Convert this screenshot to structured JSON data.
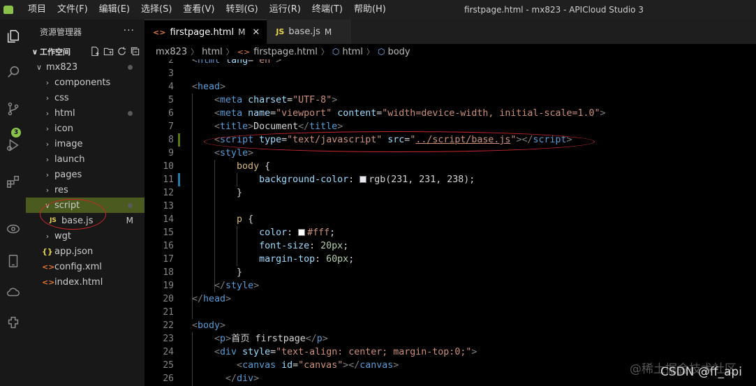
{
  "window": {
    "title": "firstpage.html - mx823 - APICloud Studio 3",
    "menu": [
      "项目",
      "文件(F)",
      "编辑(E)",
      "选择(S)",
      "查看(V)",
      "转到(G)",
      "运行(R)",
      "终端(T)",
      "帮助(H)"
    ]
  },
  "activity_bar": {
    "icons": [
      "explorer-icon",
      "search-icon",
      "source-control-icon",
      "run-debug-icon",
      "extensions-icon",
      "preview-icon",
      "device-icon",
      "cloud-icon",
      "plugin-icon"
    ],
    "scm_badge": "3"
  },
  "sidebar": {
    "title": "资源管理器",
    "more": "···",
    "workspace_label": "工作空间",
    "root": "mx823",
    "items": [
      {
        "label": "components",
        "kind": "folder",
        "expanded": false,
        "dot": false
      },
      {
        "label": "css",
        "kind": "folder",
        "expanded": false,
        "dot": false
      },
      {
        "label": "html",
        "kind": "folder",
        "expanded": false,
        "dot": true
      },
      {
        "label": "icon",
        "kind": "folder",
        "expanded": false,
        "dot": false
      },
      {
        "label": "image",
        "kind": "folder",
        "expanded": false,
        "dot": false
      },
      {
        "label": "launch",
        "kind": "folder",
        "expanded": false,
        "dot": false
      },
      {
        "label": "pages",
        "kind": "folder",
        "expanded": false,
        "dot": false
      },
      {
        "label": "res",
        "kind": "folder",
        "expanded": false,
        "dot": false
      },
      {
        "label": "script",
        "kind": "folder",
        "expanded": true,
        "dot": true
      },
      {
        "label": "base.js",
        "kind": "js",
        "flag": "M"
      },
      {
        "label": "wgt",
        "kind": "folder",
        "expanded": false,
        "dot": false
      },
      {
        "label": "app.json",
        "kind": "json"
      },
      {
        "label": "config.xml",
        "kind": "xml"
      },
      {
        "label": "index.html",
        "kind": "html"
      }
    ]
  },
  "tabs": [
    {
      "label": "firstpage.html",
      "flag": "M",
      "active": true,
      "icon": "<>"
    },
    {
      "label": "base.js",
      "flag": "M",
      "active": false,
      "icon": "JS"
    }
  ],
  "breadcrumb": [
    "mx823",
    "html",
    "firstpage.html",
    "html",
    "body"
  ],
  "editor": {
    "lines": [
      {
        "n": "2",
        "tokens": [
          [
            "br",
            "<"
          ],
          [
            "tag",
            "html"
          ],
          [
            "txt",
            " "
          ],
          [
            "attr",
            "lang"
          ],
          [
            "txt",
            "="
          ],
          [
            "str",
            "\"en\""
          ],
          [
            "br",
            ">"
          ]
        ]
      },
      {
        "n": "3",
        "tokens": []
      },
      {
        "n": "4",
        "tokens": [
          [
            "br",
            "<"
          ],
          [
            "tag",
            "head"
          ],
          [
            "br",
            ">"
          ]
        ]
      },
      {
        "n": "5",
        "tokens": [
          [
            "txt",
            "    "
          ],
          [
            "br",
            "<"
          ],
          [
            "tag",
            "meta"
          ],
          [
            "txt",
            " "
          ],
          [
            "attr",
            "charset"
          ],
          [
            "txt",
            "="
          ],
          [
            "str",
            "\"UTF-8\""
          ],
          [
            "br",
            ">"
          ]
        ]
      },
      {
        "n": "6",
        "tokens": [
          [
            "txt",
            "    "
          ],
          [
            "br",
            "<"
          ],
          [
            "tag",
            "meta"
          ],
          [
            "txt",
            " "
          ],
          [
            "attr",
            "name"
          ],
          [
            "txt",
            "="
          ],
          [
            "str",
            "\"viewport\""
          ],
          [
            "txt",
            " "
          ],
          [
            "attr",
            "content"
          ],
          [
            "txt",
            "="
          ],
          [
            "str",
            "\"width=device-width, initial-scale=1.0\""
          ],
          [
            "br",
            ">"
          ]
        ]
      },
      {
        "n": "7",
        "tokens": [
          [
            "txt",
            "    "
          ],
          [
            "br",
            "<"
          ],
          [
            "tag",
            "title"
          ],
          [
            "br",
            ">"
          ],
          [
            "txt",
            "Document"
          ],
          [
            "br",
            "</"
          ],
          [
            "tag",
            "title"
          ],
          [
            "br",
            ">"
          ]
        ]
      },
      {
        "n": "8",
        "tokens": [
          [
            "txt",
            "    "
          ],
          [
            "br",
            "<"
          ],
          [
            "tag",
            "script"
          ],
          [
            "txt",
            " "
          ],
          [
            "attr",
            "type"
          ],
          [
            "txt",
            "="
          ],
          [
            "str",
            "\"text/javascript\""
          ],
          [
            "txt",
            " "
          ],
          [
            "attr",
            "src"
          ],
          [
            "txt",
            "="
          ],
          [
            "str",
            "\""
          ],
          [
            "strlink",
            "../script/base.js"
          ],
          [
            "str",
            "\""
          ],
          [
            "br",
            "></"
          ],
          [
            "tag",
            "script"
          ],
          [
            "br",
            ">"
          ]
        ]
      },
      {
        "n": "9",
        "tokens": [
          [
            "txt",
            "    "
          ],
          [
            "br",
            "<"
          ],
          [
            "tag",
            "style"
          ],
          [
            "br",
            ">"
          ]
        ]
      },
      {
        "n": "10",
        "tokens": [
          [
            "txt",
            "        "
          ],
          [
            "sel",
            "body"
          ],
          [
            "txt",
            " {"
          ]
        ]
      },
      {
        "n": "11",
        "tokens": [
          [
            "txt",
            "            "
          ],
          [
            "prop",
            "background-color"
          ],
          [
            "txt",
            ": "
          ],
          [
            "swatch",
            "#e7e7ee"
          ],
          [
            "txt",
            "rgb(231, 231, 238);"
          ]
        ]
      },
      {
        "n": "12",
        "tokens": [
          [
            "txt",
            "        }"
          ]
        ]
      },
      {
        "n": "13",
        "tokens": []
      },
      {
        "n": "14",
        "tokens": [
          [
            "txt",
            "        "
          ],
          [
            "sel",
            "p"
          ],
          [
            "txt",
            " {"
          ]
        ]
      },
      {
        "n": "15",
        "tokens": [
          [
            "txt",
            "            "
          ],
          [
            "prop",
            "color"
          ],
          [
            "txt",
            ": "
          ],
          [
            "swatch",
            "#ffffff"
          ],
          [
            "str",
            "#fff"
          ],
          [
            "txt",
            ";"
          ]
        ]
      },
      {
        "n": "16",
        "tokens": [
          [
            "txt",
            "            "
          ],
          [
            "prop",
            "font-size"
          ],
          [
            "txt",
            ": "
          ],
          [
            "num",
            "20px"
          ],
          [
            "txt",
            ";"
          ]
        ]
      },
      {
        "n": "17",
        "tokens": [
          [
            "txt",
            "            "
          ],
          [
            "prop",
            "margin-top"
          ],
          [
            "txt",
            ": "
          ],
          [
            "num",
            "60px"
          ],
          [
            "txt",
            ";"
          ]
        ]
      },
      {
        "n": "18",
        "tokens": [
          [
            "txt",
            "        }"
          ]
        ]
      },
      {
        "n": "19",
        "tokens": [
          [
            "txt",
            "    "
          ],
          [
            "br",
            "</"
          ],
          [
            "tag",
            "style"
          ],
          [
            "br",
            ">"
          ]
        ]
      },
      {
        "n": "20",
        "tokens": [
          [
            "br",
            "</"
          ],
          [
            "tag",
            "head"
          ],
          [
            "br",
            ">"
          ]
        ]
      },
      {
        "n": "21",
        "tokens": []
      },
      {
        "n": "22",
        "tokens": [
          [
            "br",
            "<"
          ],
          [
            "tag",
            "body"
          ],
          [
            "br",
            ">"
          ]
        ]
      },
      {
        "n": "23",
        "tokens": [
          [
            "txt",
            "    "
          ],
          [
            "br",
            "<"
          ],
          [
            "tag",
            "p"
          ],
          [
            "br",
            ">"
          ],
          [
            "txt",
            "首页 firstpage"
          ],
          [
            "br",
            "</"
          ],
          [
            "tag",
            "p"
          ],
          [
            "br",
            ">"
          ]
        ]
      },
      {
        "n": "24",
        "tokens": [
          [
            "txt",
            "    "
          ],
          [
            "br",
            "<"
          ],
          [
            "tag",
            "div"
          ],
          [
            "txt",
            " "
          ],
          [
            "attr",
            "style"
          ],
          [
            "txt",
            "="
          ],
          [
            "str",
            "\"text-align: center; margin-top:0;\""
          ],
          [
            "br",
            ">"
          ]
        ]
      },
      {
        "n": "25",
        "tokens": [
          [
            "txt",
            "        "
          ],
          [
            "br",
            "<"
          ],
          [
            "tag",
            "canvas"
          ],
          [
            "txt",
            " "
          ],
          [
            "attr",
            "id"
          ],
          [
            "txt",
            "="
          ],
          [
            "str",
            "\"canvas\""
          ],
          [
            "br",
            "></"
          ],
          [
            "tag",
            "canvas"
          ],
          [
            "br",
            ">"
          ]
        ]
      },
      {
        "n": "26",
        "tokens": [
          [
            "txt",
            "      "
          ],
          [
            "br",
            "</"
          ],
          [
            "tag",
            "div"
          ],
          [
            "br",
            ">"
          ]
        ]
      }
    ]
  },
  "watermark": "@稀土掘金技术社区",
  "csdn_mark": "CSDN @ff_api",
  "colors": {
    "accent_green": "#8bc34a",
    "annotation_red": "#c8282d",
    "selected_row": "#4b5a1e"
  }
}
